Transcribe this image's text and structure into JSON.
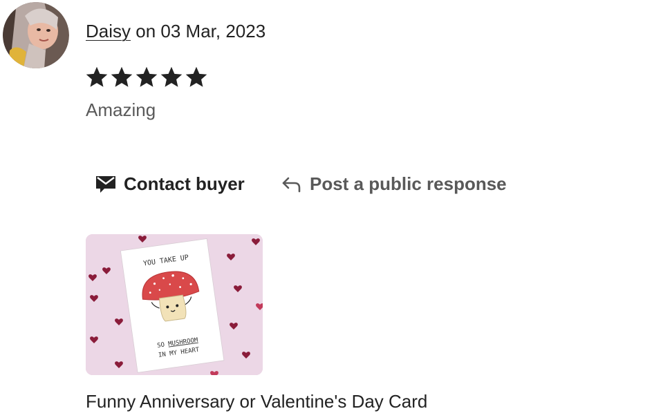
{
  "review": {
    "reviewer_name": "Daisy",
    "date_text": "on 03 Mar, 2023",
    "rating": 5,
    "rating_max": 5,
    "text": "Amazing"
  },
  "actions": {
    "contact_label": "Contact buyer",
    "respond_label": "Post a public response"
  },
  "product": {
    "title": "Funny Anniversary or Valentine's Day Card",
    "card_line1": "YOU TAKE UP",
    "card_line2_prefix": "SO ",
    "card_line2_emph": "MUSHROOM",
    "card_line3": "IN MY HEART"
  },
  "icons": {
    "star": "star-icon",
    "mail": "mail-icon",
    "reply": "reply-arrow-icon"
  },
  "colors": {
    "text": "#222222",
    "muted": "#595959",
    "card_bg": "#ecd7e6",
    "mushroom_cap": "#d9494a"
  }
}
